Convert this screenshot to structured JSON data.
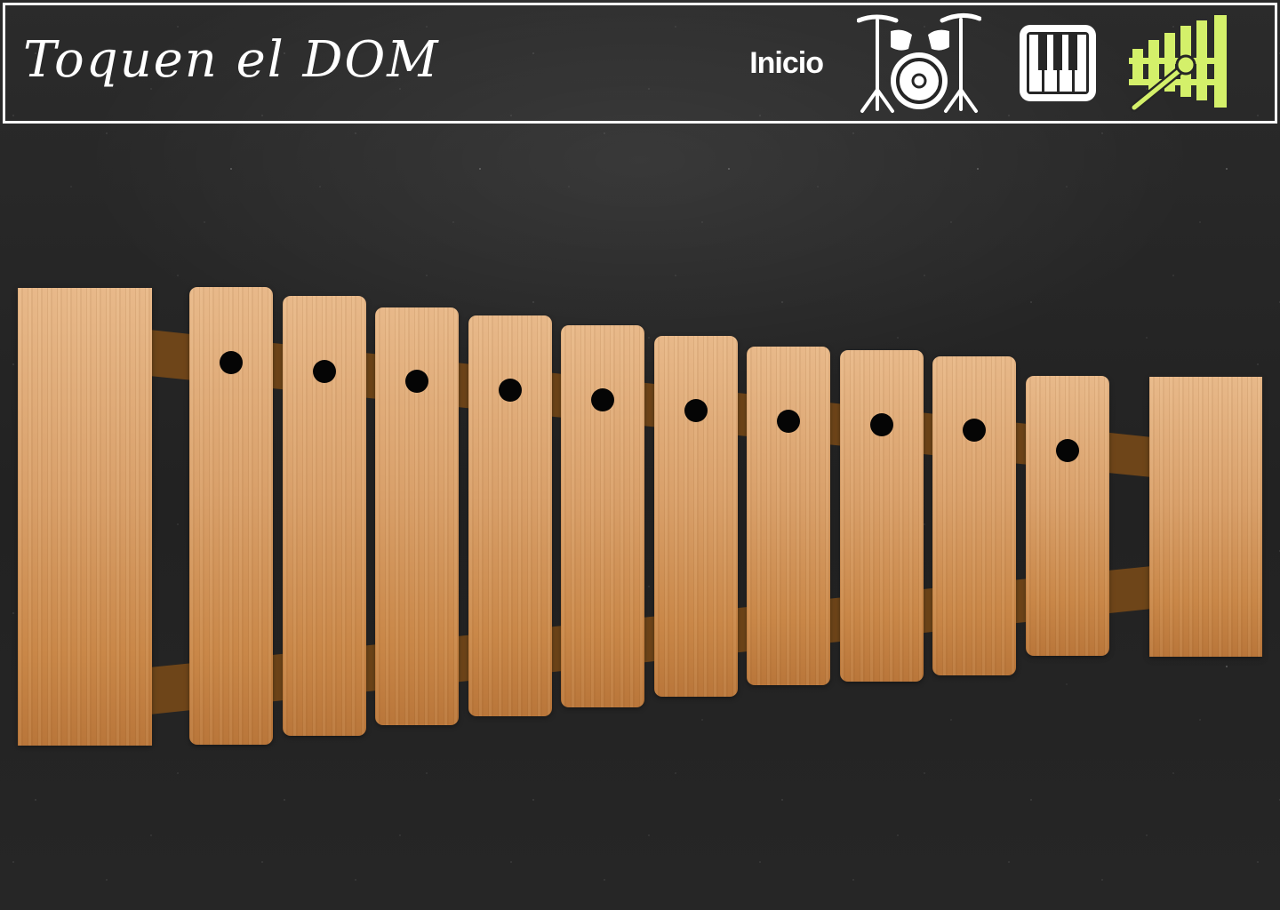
{
  "header": {
    "title": "Toquen el DOM",
    "nav": {
      "home_label": "Inicio",
      "icons": [
        "drum-kit-icon",
        "piano-icon",
        "xylophone-icon"
      ]
    }
  },
  "colors": {
    "header_border": "#ffffff",
    "active_instrument": "#d4f06a",
    "wood": "#d9a06a",
    "rail": "#6e4519",
    "background": "#262626"
  },
  "xylophone": {
    "active_instrument": "xylophone",
    "key_count": 10
  }
}
